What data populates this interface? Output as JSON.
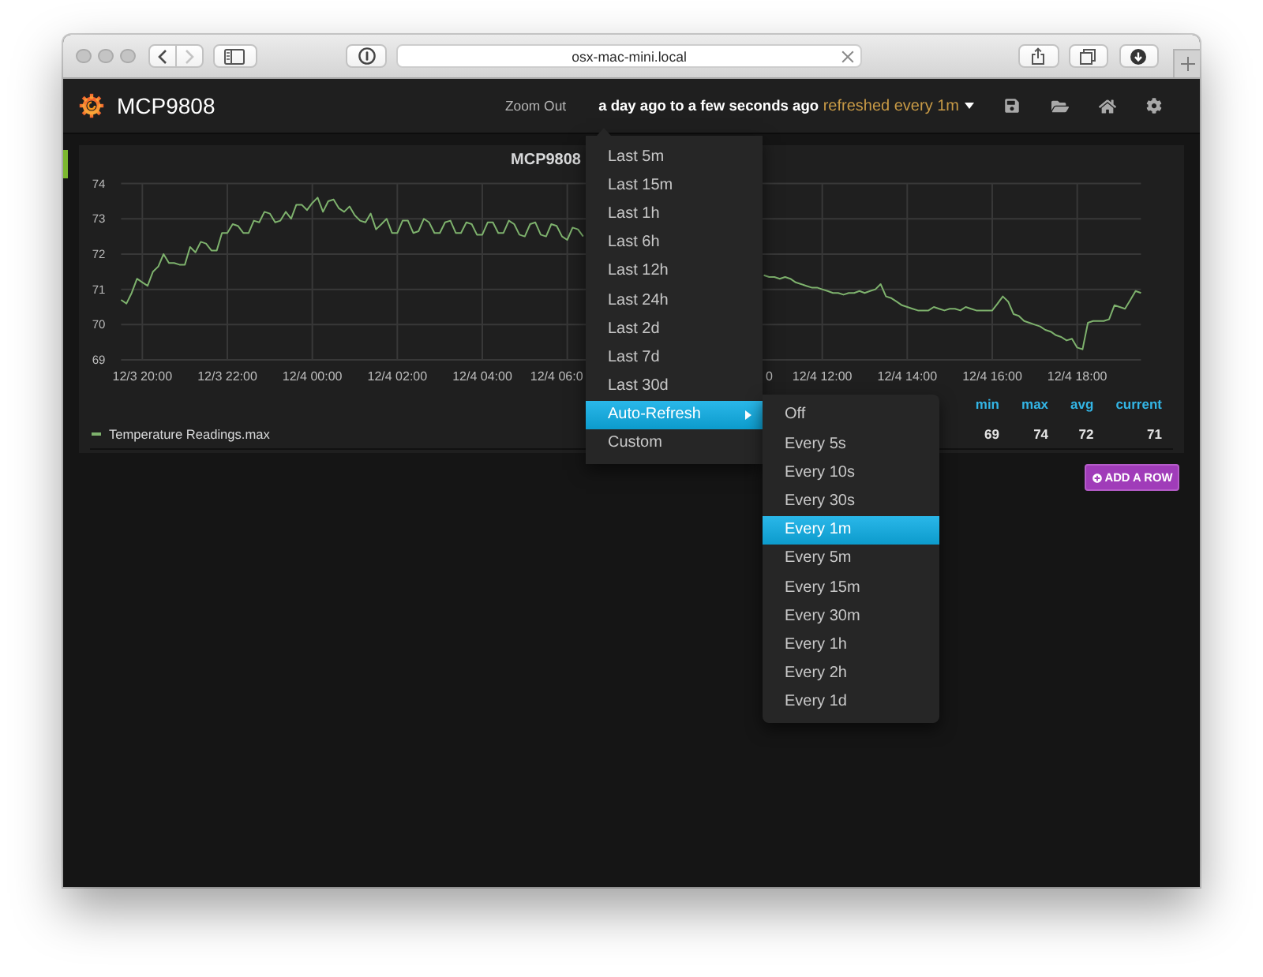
{
  "browser": {
    "nav_buttons": [
      {
        "kind": "back",
        "disabled": false
      },
      {
        "kind": "forward",
        "disabled": true
      }
    ],
    "address": "osx-mac-mini.local"
  },
  "navbar": {
    "title": "MCP9808",
    "zoom_out": "Zoom Out",
    "time_range": "a day ago to a few seconds ago",
    "refresh": "refreshed every 1m"
  },
  "time_menu": {
    "items": [
      {
        "label": "Last 5m",
        "kind": "option",
        "highlighted": false
      },
      {
        "label": "Last 15m",
        "kind": "option",
        "highlighted": false
      },
      {
        "label": "Last 1h",
        "kind": "option",
        "highlighted": false
      },
      {
        "label": "Last 6h",
        "kind": "option",
        "highlighted": false
      },
      {
        "label": "Last 12h",
        "kind": "option",
        "highlighted": false
      },
      {
        "label": "Last 24h",
        "kind": "option",
        "highlighted": false
      },
      {
        "label": "Last 2d",
        "kind": "option",
        "highlighted": false
      },
      {
        "label": "Last 7d",
        "kind": "option",
        "highlighted": false
      },
      {
        "label": "Last 30d",
        "kind": "option",
        "highlighted": false
      },
      {
        "label": "Auto-Refresh",
        "kind": "submenu",
        "highlighted": true
      },
      {
        "label": "Custom",
        "kind": "option",
        "highlighted": false
      }
    ]
  },
  "refresh_menu": {
    "items": [
      {
        "label": "Off",
        "selected": false
      },
      {
        "label": "Every 5s",
        "selected": false
      },
      {
        "label": "Every 10s",
        "selected": false
      },
      {
        "label": "Every 30s",
        "selected": false
      },
      {
        "label": "Every 1m",
        "selected": true
      },
      {
        "label": "Every 5m",
        "selected": false
      },
      {
        "label": "Every 15m",
        "selected": false
      },
      {
        "label": "Every 30m",
        "selected": false
      },
      {
        "label": "Every 1h",
        "selected": false
      },
      {
        "label": "Every 2h",
        "selected": false
      },
      {
        "label": "Every 1d",
        "selected": false
      }
    ]
  },
  "panel": {
    "chart_data": {
      "type": "line",
      "title": "MCP9808",
      "grid": true,
      "categories": [
        null,
        null,
        null,
        null,
        "12/3 20:00",
        null,
        null,
        null,
        null,
        null,
        null,
        null,
        null,
        null,
        null,
        null,
        null,
        null,
        null,
        null,
        "12/3 22:00",
        null,
        null,
        null,
        null,
        null,
        null,
        null,
        null,
        null,
        null,
        null,
        null,
        null,
        null,
        null,
        "12/4 00:00",
        null,
        null,
        null,
        null,
        null,
        null,
        null,
        null,
        null,
        null,
        null,
        null,
        null,
        null,
        null,
        "12/4 02:00",
        null,
        null,
        null,
        null,
        null,
        null,
        null,
        null,
        null,
        null,
        null,
        null,
        null,
        null,
        null,
        "12/4 04:00",
        null,
        null,
        null,
        null,
        null,
        null,
        null,
        null,
        null,
        null,
        null,
        null,
        null,
        "12/4 06:0",
        null,
        null,
        null,
        null,
        null,
        null,
        null,
        null,
        null,
        null,
        null,
        null,
        null,
        null,
        null,
        null,
        null,
        null,
        null,
        null,
        null,
        null,
        null,
        null,
        null,
        null,
        null,
        null,
        null,
        null,
        null,
        null,
        null,
        null,
        null,
        null,
        null,
        null,
        null,
        "0",
        null,
        null,
        null,
        null,
        null,
        null,
        null,
        null,
        null,
        "12/4 12:00",
        null,
        null,
        null,
        null,
        null,
        null,
        null,
        null,
        null,
        null,
        null,
        null,
        null,
        null,
        null,
        "12/4 14:00",
        null,
        null,
        null,
        null,
        null,
        null,
        null,
        null,
        null,
        null,
        null,
        null,
        null,
        null,
        null,
        "12/4 16:00",
        null,
        null,
        null,
        null,
        null,
        null,
        null,
        null,
        null,
        null,
        null,
        null,
        null,
        null,
        null,
        "12/4 18:00",
        null,
        null,
        null,
        null,
        null,
        null,
        null,
        null,
        null,
        null,
        null,
        null
      ],
      "series": [
        {
          "name": "Temperature Readings.max",
          "color": "#7eb26d",
          "values": [
            70.7,
            70.6,
            70.9,
            71.3,
            71.2,
            71.1,
            71.5,
            71.65,
            72.0,
            71.75,
            71.75,
            71.7,
            71.7,
            72.2,
            72.05,
            72.35,
            72.3,
            72.1,
            72.1,
            72.6,
            72.6,
            72.85,
            72.8,
            72.6,
            72.6,
            72.95,
            72.9,
            73.2,
            73.15,
            72.9,
            72.95,
            73.2,
            73.0,
            73.4,
            73.4,
            73.25,
            73.45,
            73.6,
            73.2,
            73.5,
            73.55,
            73.3,
            73.2,
            73.35,
            73.1,
            72.95,
            72.9,
            73.15,
            72.7,
            72.85,
            73.0,
            72.6,
            72.6,
            72.95,
            72.95,
            72.6,
            72.65,
            73.0,
            72.9,
            72.6,
            72.6,
            72.9,
            72.95,
            72.6,
            72.6,
            72.9,
            72.85,
            72.55,
            72.55,
            72.9,
            72.9,
            72.6,
            72.6,
            72.95,
            72.85,
            72.55,
            72.5,
            72.85,
            72.9,
            72.55,
            72.5,
            72.85,
            72.8,
            72.5,
            72.4,
            72.75,
            72.7,
            72.5,
            null,
            null,
            null,
            null,
            null,
            null,
            null,
            null,
            null,
            null,
            null,
            null,
            null,
            null,
            null,
            null,
            null,
            null,
            null,
            null,
            null,
            null,
            null,
            null,
            null,
            null,
            null,
            null,
            null,
            null,
            null,
            null,
            null,
            71.4,
            71.35,
            71.35,
            71.3,
            71.35,
            71.3,
            71.2,
            71.15,
            71.1,
            71.05,
            71.05,
            71.0,
            70.95,
            70.9,
            70.9,
            70.85,
            70.9,
            70.9,
            70.95,
            70.9,
            70.95,
            71.0,
            71.15,
            70.8,
            70.75,
            70.65,
            70.55,
            70.5,
            70.45,
            70.4,
            70.4,
            70.4,
            70.5,
            70.45,
            70.4,
            70.45,
            70.45,
            70.4,
            70.5,
            70.45,
            70.4,
            70.4,
            70.4,
            70.4,
            70.6,
            70.8,
            70.65,
            70.3,
            70.25,
            70.1,
            70.05,
            70.0,
            69.95,
            69.85,
            69.8,
            69.7,
            69.65,
            69.55,
            69.6,
            69.35,
            69.3,
            70.05,
            70.1,
            70.1,
            70.1,
            70.15,
            70.55,
            70.5,
            70.45,
            70.7,
            70.95,
            70.9
          ]
        }
      ],
      "ylim": [
        69,
        74
      ],
      "yticks": [
        69,
        70,
        71,
        72,
        73,
        74
      ]
    },
    "legend": {
      "columns": [
        {
          "label": "min",
          "value": "69"
        },
        {
          "label": "max",
          "value": "74"
        },
        {
          "label": "avg",
          "value": "72"
        },
        {
          "label": "current",
          "value": "71"
        }
      ]
    }
  },
  "add_row": "ADD A ROW"
}
